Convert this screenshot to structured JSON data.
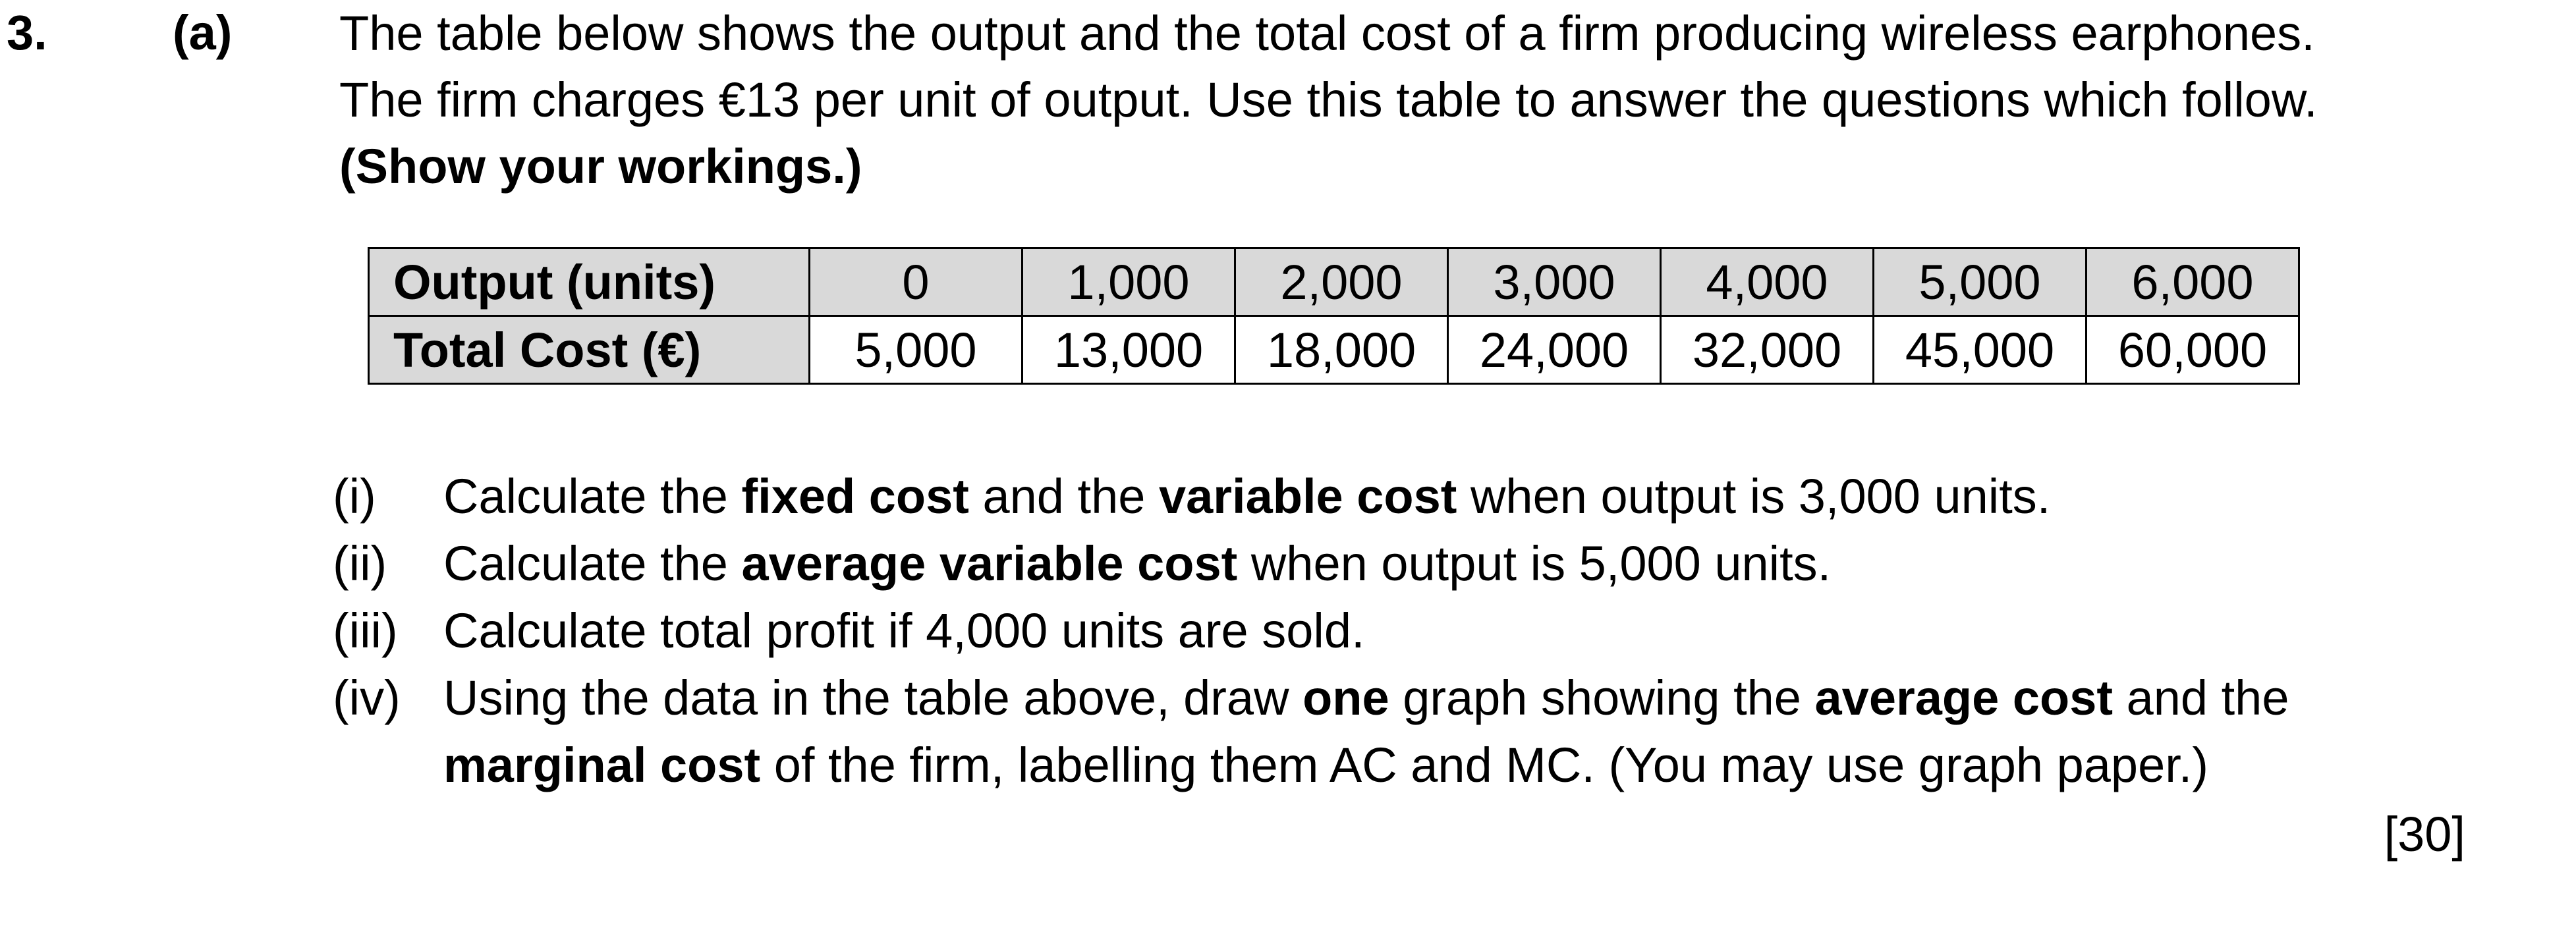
{
  "question": {
    "number": "3.",
    "part": "(a)",
    "intro": {
      "line1": "The table below shows the output and the total cost of a firm producing wireless earphones.",
      "line2": "The firm charges €13 per unit of output.  Use this table to answer the questions which follow.",
      "line3": "(Show your workings.)"
    },
    "table": {
      "rows": [
        {
          "header": "Output (units)",
          "values": [
            "0",
            "1,000",
            "2,000",
            "3,000",
            "4,000",
            "5,000",
            "6,000"
          ]
        },
        {
          "header": "Total Cost (€)",
          "values": [
            "5,000",
            "13,000",
            "18,000",
            "24,000",
            "32,000",
            "45,000",
            "60,000"
          ]
        }
      ]
    },
    "subquestions": [
      {
        "numeral": "(i)",
        "t1": "Calculate the ",
        "b1": "fixed cost",
        "t2": " and the ",
        "b2": "variable cost",
        "t3": " when output is 3,000 units."
      },
      {
        "numeral": "(ii)",
        "t1": "Calculate the ",
        "b1": "average variable cost",
        "t2": " when output is 5,000 units."
      },
      {
        "numeral": "(iii)",
        "t1": "Calculate total profit if 4,000 units are sold."
      },
      {
        "numeral": "(iv)",
        "t1": "Using the data in the table above, draw ",
        "b1": "one",
        "t2": " graph showing the ",
        "b2": "average cost",
        "t3": " and the",
        "c_b1": "marginal cost",
        "c_t1": " of the firm, labelling them AC and MC. (You may use graph paper.)"
      }
    ],
    "marks": "[30]"
  }
}
